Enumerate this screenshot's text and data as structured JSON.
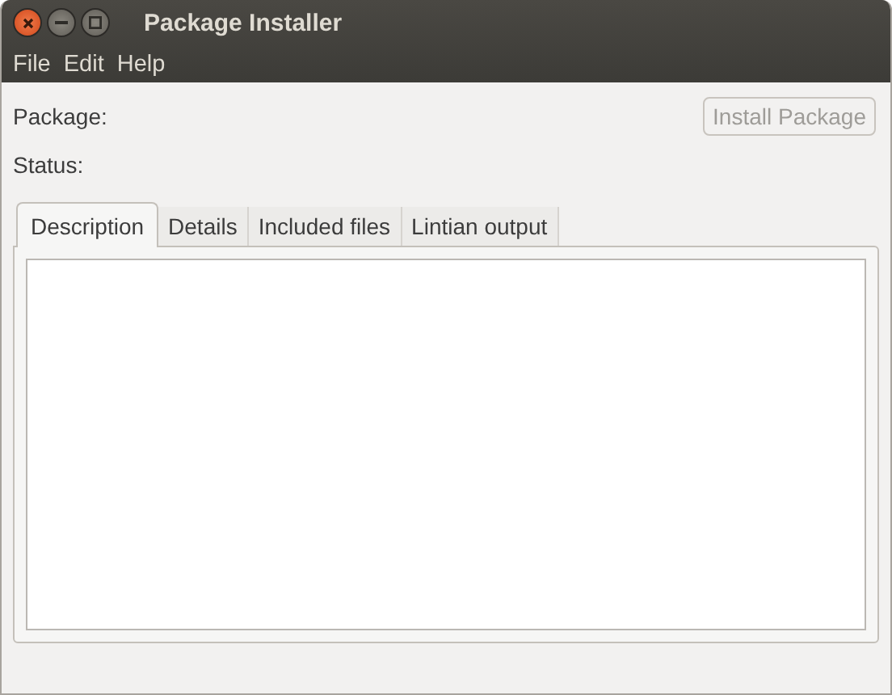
{
  "window": {
    "title": "Package Installer"
  },
  "menu": [
    "File",
    "Edit",
    "Help"
  ],
  "fields": [
    {
      "label": "Package:"
    },
    {
      "label": "Status:"
    }
  ],
  "install_button": {
    "label": "Install Package",
    "disabled": true
  },
  "tabs": [
    {
      "label": "Description",
      "selected": true
    },
    {
      "label": "Details",
      "selected": false
    },
    {
      "label": "Included files",
      "selected": false
    },
    {
      "label": "Lintian output",
      "selected": false
    }
  ]
}
